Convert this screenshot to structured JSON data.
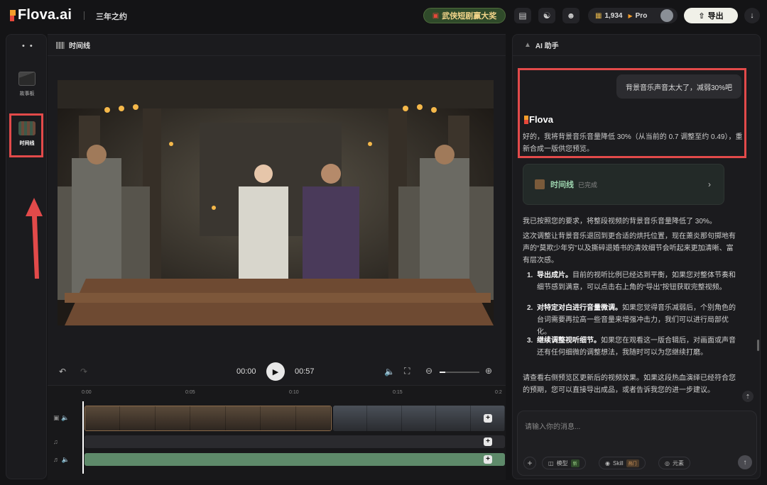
{
  "app": {
    "brand": "Flova.ai",
    "project_title": "三年之约"
  },
  "topbar": {
    "promo_label": "武侠短剧赢大奖",
    "credits": "1,934",
    "plan": "Pro",
    "export_label": "导出"
  },
  "sidebar": {
    "items": [
      {
        "label": "故事板",
        "icon": "clapperboard-icon"
      },
      {
        "label": "时间线",
        "icon": "film-strip-icon",
        "active": true
      }
    ]
  },
  "center": {
    "header": "时间线",
    "current_time": "00:00",
    "total_time": "00:57",
    "zoom_level": 0.15,
    "ruler_ticks": [
      "0:00",
      "0:05",
      "0:10",
      "0:15",
      "0:2"
    ]
  },
  "assistant": {
    "header": "AI 助手",
    "user_message": "背景音乐声音太大了，减弱30%吧",
    "ai_brand": "Flova",
    "ai_reply": "好的，我将背景音乐音量降低 30%（从当前的 0.7 调整至约 0.49），重新合成一版供您预览。",
    "timeline_card": {
      "title": "时间线",
      "status": "已完成"
    },
    "summary": "我已按照您的要求，将整段视频的背景音乐音量降低了 30%。",
    "detail": "这次调整让背景音乐退回到更合适的烘托位置，现在萧炎那句掷地有声的“莫欺少年穷”以及撕碎退婚书的清效细节会听起来更加清晰、富有层次感。",
    "steps": [
      {
        "num": "1.",
        "title": "导出成片。",
        "text": "目前的视听比例已经达到平衡，如果您对整体节奏和细节感到满意，可以点击右上角的“导出”按钮获取完整视频。"
      },
      {
        "num": "2.",
        "title": "对特定对白进行音量微调。",
        "text": "如果您觉得音乐减弱后，个别角色的台词需要再拉高一些音量来增强冲击力，我们可以进行局部优化。"
      },
      {
        "num": "3.",
        "title": "继续调整视听细节。",
        "text": "如果您在观看这一版合辑后，对画面或声音还有任何细微的调整想法，我随时可以为您继续打磨。"
      }
    ],
    "closing": "请查看右侧预览区更新后的视频效果。如果这段热血演绎已经符合您的预期，您可以直接导出成品，或者告诉我您的进一步建议。",
    "input_placeholder": "请输入你的消息...",
    "chips": [
      {
        "label": "模型",
        "tag": "新"
      },
      {
        "label": "Skill",
        "tag": "热门"
      },
      {
        "label": "元素",
        "tag": ""
      }
    ]
  },
  "colors": {
    "accent_red": "#e24a4a",
    "music_track": "#5e8a6a",
    "timeline_card_text": "#9ed6b0"
  }
}
